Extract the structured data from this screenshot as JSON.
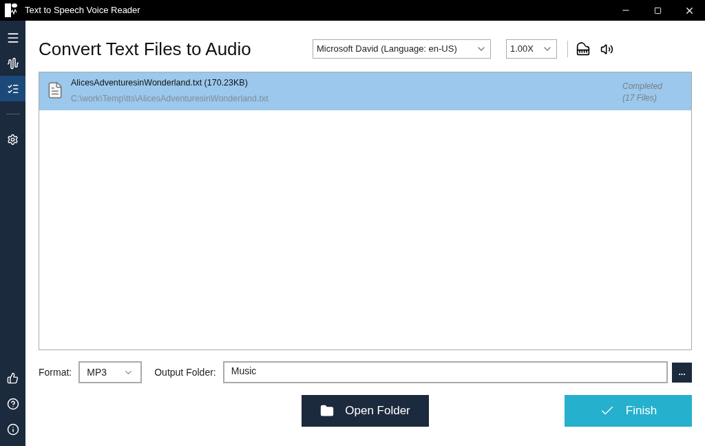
{
  "window": {
    "title": "Text to Speech Voice Reader"
  },
  "sidebar": {
    "items": [
      {
        "kind": "menu",
        "selected": false
      },
      {
        "kind": "wave",
        "selected": false
      },
      {
        "kind": "list",
        "selected": true
      },
      {
        "kind": "divider"
      },
      {
        "kind": "settings",
        "selected": false
      }
    ],
    "bottom_items": [
      {
        "kind": "like"
      },
      {
        "kind": "help"
      },
      {
        "kind": "info"
      }
    ]
  },
  "heading": "Convert Text Files to Audio",
  "voice": {
    "value": "Microsoft David (Language: en-US)"
  },
  "speed": {
    "value": "1.00X"
  },
  "files": [
    {
      "name": "AlicesAdventuresinWonderland.txt (170.23KB)",
      "path": "C:\\work\\Temp\\tts\\AlicesAdventuresinWonderland.txt",
      "status_lines": [
        "Completed",
        "(17 Files)"
      ],
      "selected": true
    }
  ],
  "format": {
    "label": "Format:",
    "value": "MP3"
  },
  "output": {
    "label": "Output Folder:",
    "value": "Music",
    "browse": "..."
  },
  "buttons": [
    {
      "kind": "open",
      "label": "Open Folder"
    },
    {
      "kind": "finish",
      "label": "Finish"
    }
  ]
}
